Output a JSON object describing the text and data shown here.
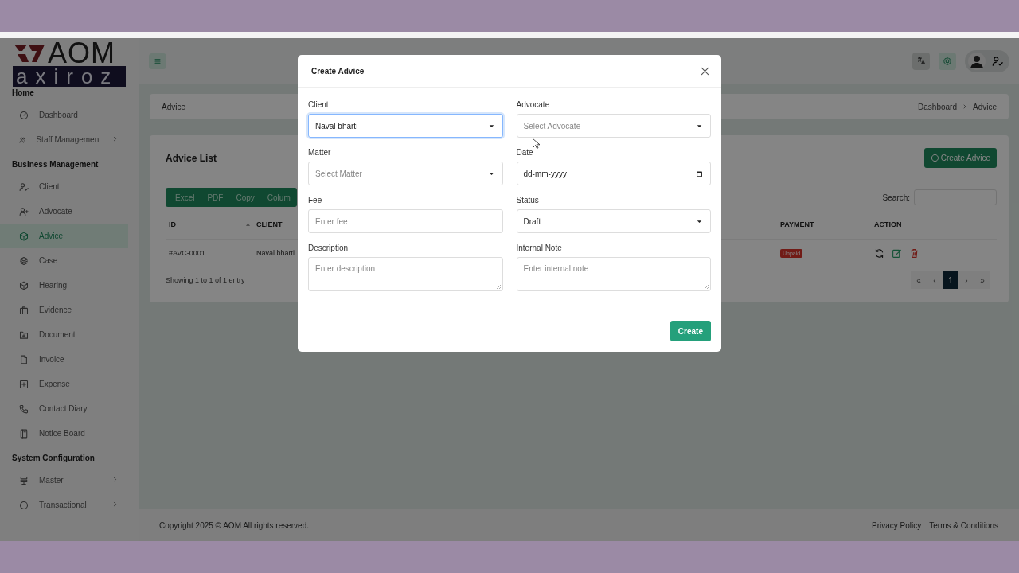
{
  "logo": {
    "mark": "AOM",
    "wordmark": "axiroz"
  },
  "sidebar": {
    "sections": [
      {
        "title": "Home",
        "items": [
          {
            "label": "Dashboard",
            "selected": false,
            "submenu": false
          },
          {
            "label": "Staff Management",
            "selected": false,
            "submenu": true
          }
        ]
      },
      {
        "title": "Business Management",
        "items": [
          {
            "label": "Client",
            "selected": false,
            "submenu": false
          },
          {
            "label": "Advocate",
            "selected": false,
            "submenu": false
          },
          {
            "label": "Advice",
            "selected": true,
            "submenu": false
          },
          {
            "label": "Case",
            "selected": false,
            "submenu": false
          },
          {
            "label": "Hearing",
            "selected": false,
            "submenu": false
          },
          {
            "label": "Evidence",
            "selected": false,
            "submenu": false
          },
          {
            "label": "Document",
            "selected": false,
            "submenu": false
          },
          {
            "label": "Invoice",
            "selected": false,
            "submenu": false
          },
          {
            "label": "Expense",
            "selected": false,
            "submenu": false
          },
          {
            "label": "Contact Diary",
            "selected": false,
            "submenu": false
          },
          {
            "label": "Notice Board",
            "selected": false,
            "submenu": false
          }
        ]
      },
      {
        "title": "System Configuration",
        "items": [
          {
            "label": "Master",
            "selected": false,
            "submenu": true
          },
          {
            "label": "Transactional",
            "selected": false,
            "submenu": true
          }
        ]
      }
    ]
  },
  "breadcrumb": {
    "title": "Advice",
    "trail": [
      "Dashboard",
      "Advice"
    ]
  },
  "advice_list": {
    "title": "Advice List",
    "create_button": "Create Advice",
    "export_buttons": [
      "Excel",
      "PDF",
      "Copy",
      "Colum"
    ],
    "search_label": "Search:",
    "columns": [
      {
        "label": "ID",
        "sorted": true
      },
      {
        "label": "CLIENT",
        "sorted": false
      },
      {
        "label": "PAYMENT",
        "sorted": false
      },
      {
        "label": "ACTION",
        "sorted": false
      }
    ],
    "rows": [
      {
        "id": "#AVC-0001",
        "client": "Naval bharti",
        "payment": "Unpaid"
      }
    ],
    "info": "Showing 1 to 1 of 1 entry",
    "pagination": [
      {
        "label": "«",
        "selected": false
      },
      {
        "label": "‹",
        "selected": false
      },
      {
        "label": "1",
        "selected": true
      },
      {
        "label": "›",
        "selected": false
      },
      {
        "label": "»",
        "selected": false
      }
    ]
  },
  "footer": {
    "copyright": "Copyright 2025 © AOM All rights reserved.",
    "links": [
      "Privacy Policy",
      "Terms & Conditions"
    ]
  },
  "modal": {
    "title": "Create Advice",
    "submit": "Create",
    "fields": [
      {
        "label": "Client",
        "kind": "select",
        "value": "Naval bharti",
        "focused": true
      },
      {
        "label": "Advocate",
        "kind": "select",
        "placeholder": "Select Advocate",
        "focused": false
      },
      {
        "label": "Matter",
        "kind": "select",
        "placeholder": "Select Matter",
        "focused": false
      },
      {
        "label": "Date",
        "kind": "date",
        "value": "dd-mm-yyyy",
        "focused": false
      },
      {
        "label": "Fee",
        "kind": "text",
        "placeholder": "Enter fee",
        "focused": false
      },
      {
        "label": "Status",
        "kind": "select",
        "value": "Draft",
        "focused": false
      },
      {
        "label": "Description",
        "kind": "textarea",
        "placeholder": "Enter description",
        "focused": false
      },
      {
        "label": "Internal Note",
        "kind": "textarea",
        "placeholder": "Enter internal note",
        "focused": false
      }
    ]
  }
}
